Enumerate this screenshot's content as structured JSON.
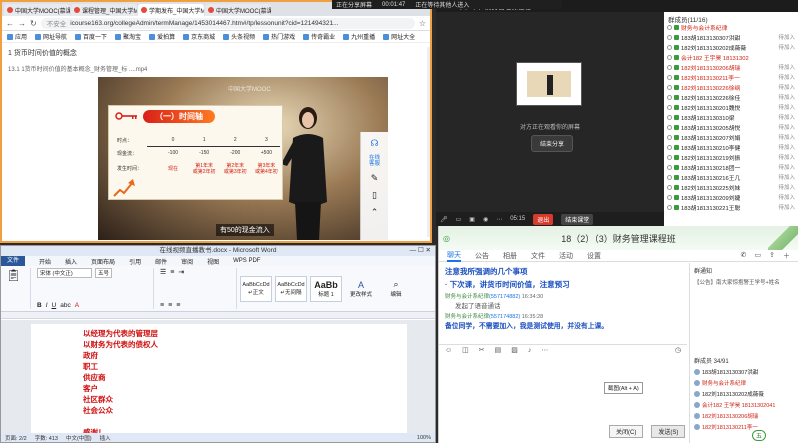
{
  "sharebar": {
    "status": "正在分享屏幕",
    "timer": "00:01:47",
    "waiting": "正在等待其他人进入"
  },
  "browser": {
    "tabs": [
      "中国大学MOOC(慕课)_优质在线",
      "课程管理_中国大学MOOC(慕课)",
      "学期发布_中国大学MOOC(慕课)",
      "中国大学MOOC(慕课)",
      "icourse163.org/..."
    ],
    "security": "不安全",
    "url": "icourse163.org/collegeAdmin/termManage/1453014467.htm#/tp/lessonunit?cid=121494321...",
    "bookmarks": [
      "应用",
      "网址导航",
      "百度一下",
      "聚淘宝",
      "爱拍算",
      "京东商城",
      "头条视频",
      "热门游戏",
      "传奇霸业",
      "九州重播",
      "网址大全"
    ],
    "course_heading": "1 货币时间价值的概念",
    "video_name": "13.1 1货币时间价值的基本概念_财务管理_标 ....mp4",
    "slide": {
      "title": "（一）时间轴",
      "rows": [
        {
          "label": "时点：",
          "cells": [
            "0",
            "1",
            "2",
            "3"
          ]
        },
        {
          "label": "现金流：",
          "cells": [
            "-100",
            "-150",
            "-200",
            "+500"
          ]
        },
        {
          "label": "发生时间：",
          "cells": [
            "现在",
            "第1年末\n或第2年初",
            "第2年末\n或第3年初",
            "第3年末\n或第4年初"
          ]
        }
      ]
    },
    "mooc_logo": "中国大学MOOC",
    "caption": "有50的现金流入",
    "side_buttons": {
      "service": "在线\n客服"
    }
  },
  "meeting": {
    "title": "18（2）（3）财务管理课程班",
    "sharing_note": "对方正在观看你的屏幕",
    "end_share": "结束分享",
    "ctrl": {
      "time": "05:15",
      "end": "退出",
      "leave": "结束课堂"
    },
    "members_header": "群成员(11/16)",
    "members": [
      {
        "name": "财务与会计系纪律",
        "status": "",
        "red": true
      },
      {
        "name": "183胡1813130307洪甜",
        "status": "待加入",
        "red": false
      },
      {
        "name": "182刘1813130202成薇薇",
        "status": "待加入",
        "red": false
      },
      {
        "name": "会计182 王宇昊 18131302",
        "status": "",
        "red": true
      },
      {
        "name": "182刘1813130206胡瑞",
        "status": "待加入",
        "red": true
      },
      {
        "name": "182刘1813130211李一",
        "status": "待加入",
        "red": true
      },
      {
        "name": "182刘1813130226徐纲",
        "status": "待加入",
        "red": true
      },
      {
        "name": "182刘1813130226徐佳",
        "status": "待加入",
        "red": false
      },
      {
        "name": "182刘1813130201魏悦",
        "status": "待加入",
        "red": false
      },
      {
        "name": "183胡1813130310梁",
        "status": "待加入",
        "red": false
      },
      {
        "name": "183胡1813130205胡悦",
        "status": "待加入",
        "red": false
      },
      {
        "name": "183胡1813130207刘娟",
        "status": "待加入",
        "red": false
      },
      {
        "name": "183胡1813130210李健",
        "status": "待加入",
        "red": false
      },
      {
        "name": "182刘1813130219刘振",
        "status": "待加入",
        "red": false
      },
      {
        "name": "183胡1813130218团一",
        "status": "待加入",
        "red": false
      },
      {
        "name": "183胡1813130216王几",
        "status": "待加入",
        "red": false
      },
      {
        "name": "182刘1813130225刘妹",
        "status": "待加入",
        "red": false
      },
      {
        "name": "183胡1813130209刘婕",
        "status": "待加入",
        "red": false
      },
      {
        "name": "183胡1813130221王聪",
        "status": "待加入",
        "red": false
      }
    ]
  },
  "word": {
    "title": "在线视频直播教书.docx - Microsoft Word",
    "tabs": [
      "文件",
      "开始",
      "插入",
      "页面布局",
      "引用",
      "邮件",
      "审阅",
      "视图",
      "WPS PDF"
    ],
    "font": "宋体 (中文正)",
    "size": "五号",
    "styles": [
      {
        "sample": "AaBbCcDd",
        "name": "↵正文"
      },
      {
        "sample": "AaBbCcDd",
        "name": "↵无间隔"
      },
      {
        "sample": "AaBb",
        "name": "标题 1"
      }
    ],
    "change_styles": "更改样式",
    "edit": "编辑",
    "lines": [
      "以经理为代表的管理层",
      "以财务为代表的债权人",
      "政府",
      "职工",
      "供应商",
      "客户",
      "社区群众",
      "社会公众",
      "",
      "感谢！"
    ],
    "status": {
      "page": "页面: 2/2",
      "words": "字数: 413",
      "lang": "中文(中国)",
      "mode": "插入",
      "zoom": "100%"
    }
  },
  "chat": {
    "title": "18（2）（3）财务管理课程班",
    "tabs": [
      "聊天",
      "公告",
      "相册",
      "文件",
      "活动",
      "设置"
    ],
    "messages": [
      {
        "text": "注意我所强调的几个事项",
        "big": true
      },
      {
        "text": "· 下次课，讲货币时间价值，注意预习",
        "big": true
      },
      {
        "sender": "财务与会计系纪律",
        "id": "(557174882)",
        "time": "16:34:30"
      },
      {
        "text": "发起了语音通话",
        "big": false
      },
      {
        "sender": "财务与会计系纪律",
        "id": "(557174882)",
        "time": "16:35:28"
      },
      {
        "text": "备位同学，不需要加入，我是测试使用，并没有上课。",
        "big": true
      }
    ],
    "close": "关闭(C)",
    "send": "发送(S)",
    "notice_header": "群通知",
    "notice_body": "【公告】南大家惊抱警王学号+姓名",
    "group_header": "群成员 34/91",
    "group": [
      {
        "name": "183胡1813130307洪甜",
        "red": false
      },
      {
        "name": "财务与会计系纪律",
        "red": true
      },
      {
        "name": "182刘1813130202成薇薇",
        "red": false
      },
      {
        "name": "会计182 王学昊 18131302041",
        "red": true
      },
      {
        "name": "182刘1813130206胡瑞",
        "red": true
      },
      {
        "name": "182刘1813130211李一",
        "red": true
      }
    ],
    "tooltip": "截图(Alt + A)",
    "badge": "五"
  }
}
